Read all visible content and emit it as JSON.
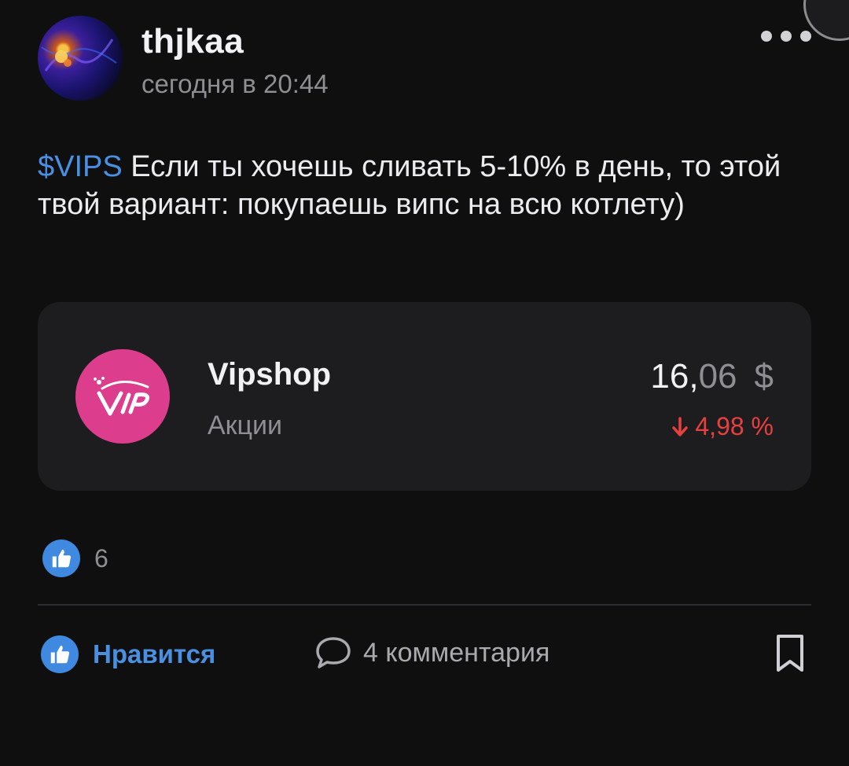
{
  "post": {
    "author": "thjkaa",
    "timestamp": "сегодня в 20:44",
    "ticker": "$VIPS",
    "text": " Если ты хочешь сливать 5-10% в день, то этой твой вариант: покупаешь випс на всю котлету)"
  },
  "stock_card": {
    "name": "Vipshop",
    "type": "Акции",
    "price_int": "16,",
    "price_frac": "06",
    "currency": "$",
    "change": "4,98 %",
    "change_direction": "down",
    "logo_color": "#dd3d8d",
    "change_color": "#e8403f"
  },
  "reactions": {
    "likes_count": "6"
  },
  "actions": {
    "like_label": "Нравится",
    "comments_label": "4 комментария"
  },
  "colors": {
    "accent": "#4a90e2",
    "background": "#0f0f10",
    "card": "#1d1d20"
  },
  "icons": {
    "more": "more-dots-icon",
    "like": "thumbs-up-icon",
    "comment": "comment-bubble-icon",
    "bookmark": "bookmark-icon",
    "change": "arrow-down-icon"
  }
}
